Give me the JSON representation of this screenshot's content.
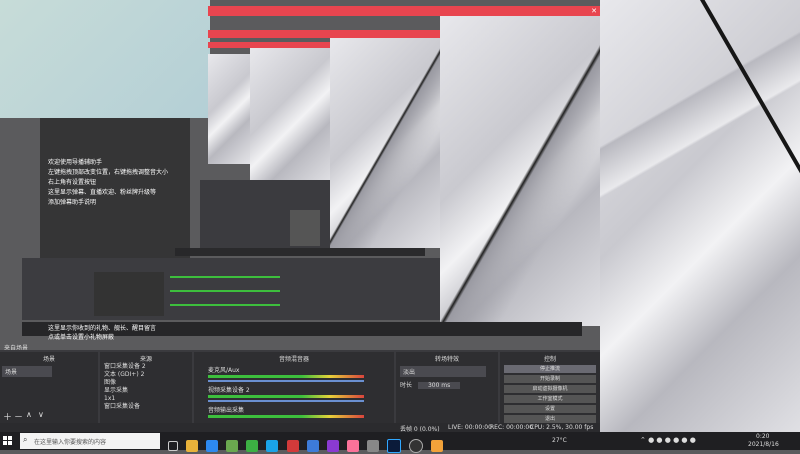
{
  "overlay": {
    "lines": [
      "欢迎使用导播辅助手",
      "左键拖拽顶部改变位置，右键拖拽调整音大小",
      "右上角有设置按钮",
      "这里显示弹幕、直播欢迎、粉丝牌升级等",
      "添加弹幕助手说明"
    ],
    "bottom_line1": "这里显示你收到的礼物、舰长、醒目留言",
    "bottom_line2": "点或单击设置小礼物屏蔽"
  },
  "obs": {
    "scene_label": "来自场景",
    "scenes_header": "场景",
    "sources_header": "来源",
    "mixer_header": "音频混音器",
    "transitions_header": "转场特效",
    "controls_header": "控制",
    "scene_item": "场景",
    "sources": [
      "窗口采集设备 2",
      "文本 (GDI+) 2",
      "图像",
      "显示采集",
      "1x1",
      "窗口采集设备"
    ],
    "mixer_tracks": [
      {
        "name": "麦克风/Aux",
        "level": 0.72
      },
      {
        "name": "视频采集设备 2",
        "level": 0.65
      },
      {
        "name": "音频输出采集",
        "level": 0.58
      }
    ],
    "transition_value": "淡出",
    "duration_label": "时长",
    "duration_value": "300 ms",
    "controls": [
      "停止推流",
      "开始录制",
      "启动虚拟摄像机",
      "工作室模式",
      "设置",
      "退出"
    ],
    "status_drop": "丢帧 0 (0.0%)",
    "status_live": "LIVE: 00:00:00",
    "status_rec": "REC: 00:00:00",
    "status_cpu": "CPU: 2.5%, 30.00 fps"
  },
  "taskbar": {
    "search_placeholder": "在这里输入你要搜索的内容",
    "weather": "27°C",
    "time": "0:20",
    "date": "2021/8/16",
    "icons": [
      "file-explorer",
      "edge",
      "store",
      "wechat",
      "qq",
      "music",
      "mail",
      "video",
      "bilibili",
      "settings",
      "photoshop",
      "obs",
      "browser"
    ]
  }
}
